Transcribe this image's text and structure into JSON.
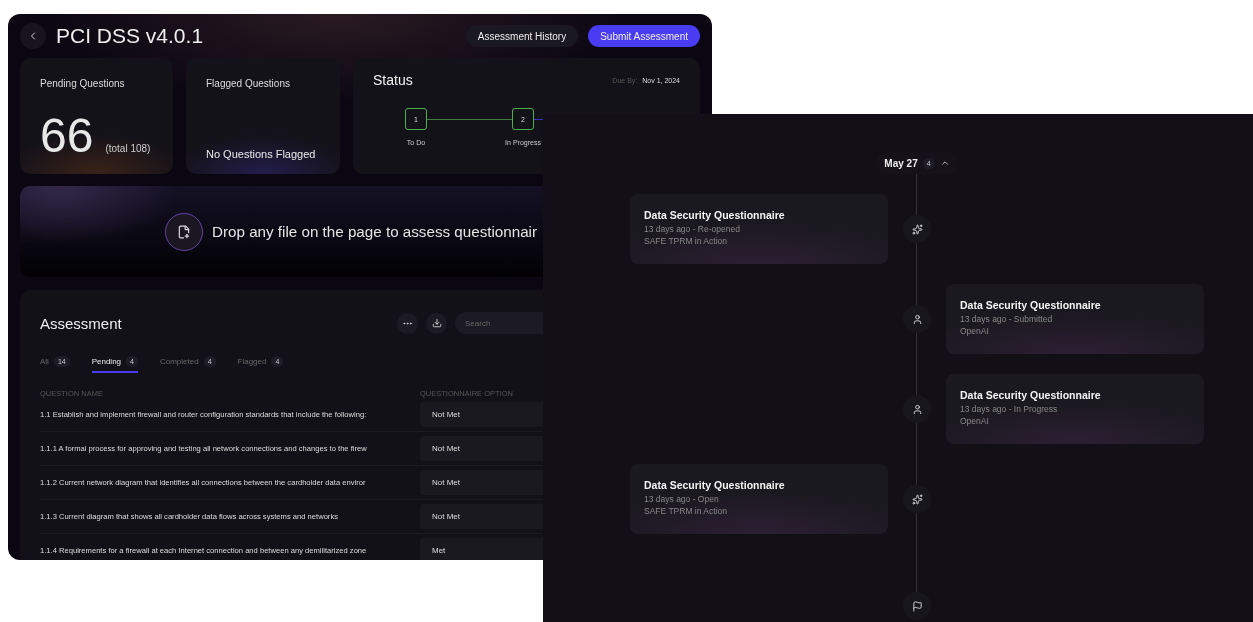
{
  "assessment_window": {
    "title": "PCI DSS v4.0.1",
    "buttons": [
      {
        "label": "Assessment History",
        "kind": "secondary"
      },
      {
        "label": "Submit Assessment",
        "kind": "primary"
      }
    ],
    "stats": [
      {
        "label": "Pending Questions",
        "kind": "count",
        "value": "66",
        "sub": "(total 108)"
      },
      {
        "label": "Flagged Questions",
        "kind": "message",
        "value": "No Questions Flagged"
      }
    ],
    "status": {
      "title": "Status",
      "due_label": "Due By:",
      "due_date": "Nov 1, 2024",
      "steps": [
        {
          "number": "1",
          "label": "To Do",
          "done": true
        },
        {
          "number": "2",
          "label": "In Progress",
          "done": true
        }
      ]
    },
    "dropzone": {
      "text": "Drop any file on the page to assess questionnair"
    },
    "assessment": {
      "title": "Assessment",
      "search": {
        "placeholder": "Search"
      },
      "tabs": [
        {
          "label": "All",
          "count": "14",
          "selected": false
        },
        {
          "label": "Pending",
          "count": "4",
          "selected": true
        },
        {
          "label": "Completed",
          "count": "4",
          "selected": false
        },
        {
          "label": "Flagged",
          "count": "4",
          "selected": false
        }
      ],
      "columns": [
        "QUESTION NAME",
        "QUESTIONNAIRE OPTION"
      ],
      "rows": [
        {
          "question": "1.1 Establish and implement firewall and router configuration standards that include the following:",
          "option": "Not Met"
        },
        {
          "question": "1.1.1 A formal process for approving and testing all network connections and changes to the firew",
          "option": "Not Met"
        },
        {
          "question": "1.1.2 Current network diagram that identifies all connections between the cardholder data enviror",
          "option": "Not Met"
        },
        {
          "question": "1.1.3 Current diagram that shows all cardholder data flows across systems and networks",
          "option": "Not Met"
        },
        {
          "question": "1.1.4 Requirements for a firewall at each Internet connection and between any demilitarized zone",
          "option": "Met"
        }
      ]
    }
  },
  "activity_window": {
    "date_group": {
      "date": "May 27",
      "count": "4",
      "expanded": true
    },
    "events": [
      {
        "kind": "ai",
        "title": "Data Security Questionnaire",
        "meta": "13 days ago - Re-opened",
        "actor": "SAFE TPRM in Action"
      },
      {
        "kind": "user",
        "title": "Data Security Questionnaire",
        "meta": "13 days ago - Submitted",
        "actor": "OpenAI"
      },
      {
        "kind": "user",
        "title": "Data Security Questionnaire",
        "meta": "13 days ago - In Progress",
        "actor": "OpenAI"
      },
      {
        "kind": "ai",
        "title": "Data Security Questionnaire",
        "meta": "13 days ago - Open",
        "actor": "SAFE TPRM in Action"
      }
    ]
  }
}
